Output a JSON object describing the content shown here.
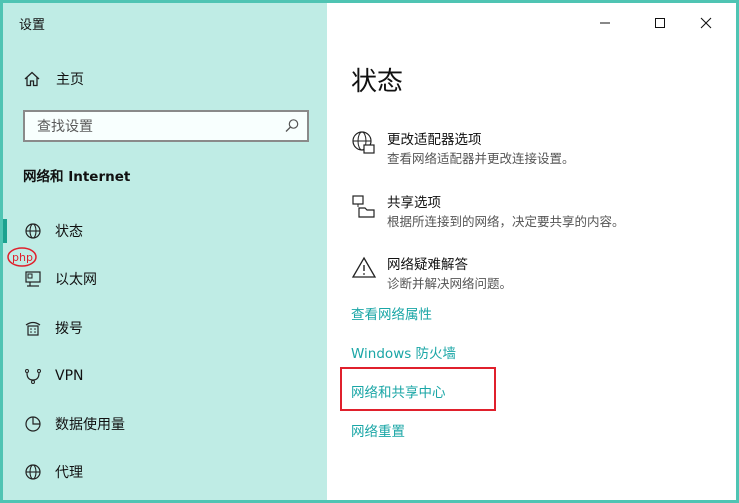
{
  "window": {
    "title": "设置"
  },
  "sidebar": {
    "home_label": "主页",
    "search_placeholder": "查找设置",
    "section_title": "网络和 Internet",
    "items": [
      {
        "label": "状态",
        "icon": "globe-icon",
        "selected": true
      },
      {
        "label": "以太网",
        "icon": "ethernet-icon",
        "selected": false
      },
      {
        "label": "拨号",
        "icon": "dialup-icon",
        "selected": false
      },
      {
        "label": "VPN",
        "icon": "vpn-icon",
        "selected": false
      },
      {
        "label": "数据使用量",
        "icon": "data-usage-icon",
        "selected": false
      },
      {
        "label": "代理",
        "icon": "proxy-globe-icon",
        "selected": false
      }
    ]
  },
  "content": {
    "heading": "状态",
    "options": [
      {
        "title": "更改适配器选项",
        "desc": "查看网络适配器并更改连接设置。",
        "icon": "network-adapter-icon"
      },
      {
        "title": "共享选项",
        "desc": "根据所连接到的网络，决定要共享的内容。",
        "icon": "sharing-icon"
      },
      {
        "title": "网络疑难解答",
        "desc": "诊断并解决网络问题。",
        "icon": "warning-icon"
      }
    ],
    "links": [
      "查看网络属性",
      "Windows 防火墙",
      "网络和共享中心",
      "网络重置"
    ],
    "watermark": "php 中文网"
  },
  "colors": {
    "accent": "#1aa6a6",
    "sidebar_bg": "#bfece5",
    "highlight": "#e0202c"
  }
}
